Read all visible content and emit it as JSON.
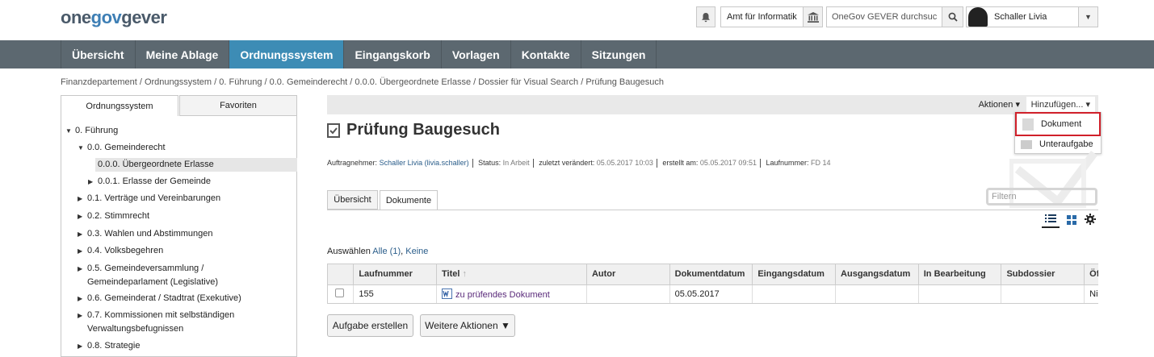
{
  "header": {
    "logo": {
      "part1": "one",
      "part2": "gov",
      "part3": "gever"
    },
    "org_label": "Amt für Informatik",
    "search_placeholder": "OneGov GEVER durchsuc",
    "user_name": "Schaller Livia"
  },
  "nav": {
    "items": [
      {
        "label": "Übersicht"
      },
      {
        "label": "Meine Ablage"
      },
      {
        "label": "Ordnungssystem",
        "active": true
      },
      {
        "label": "Eingangskorb"
      },
      {
        "label": "Vorlagen"
      },
      {
        "label": "Kontakte"
      },
      {
        "label": "Sitzungen"
      }
    ]
  },
  "breadcrumb": "Finanzdepartement / Ordnungssystem / 0. Führung / 0.0. Gemeinderecht / 0.0.0. Übergeordnete Erlasse / Dossier für Visual Search / Prüfung Baugesuch",
  "sidebar": {
    "tabs": [
      "Ordnungssystem",
      "Favoriten"
    ],
    "tree": [
      {
        "label": "0. Führung"
      },
      {
        "label": "0.0. Gemeinderecht"
      },
      {
        "label": "0.0.0. Übergeordnete Erlasse",
        "selected": true
      },
      {
        "label": "0.0.1. Erlasse der Gemeinde"
      },
      {
        "label": "0.1. Verträge und Vereinbarungen"
      },
      {
        "label": "0.2. Stimmrecht"
      },
      {
        "label": "0.3. Wahlen und Abstimmungen"
      },
      {
        "label": "0.4. Volksbegehren"
      },
      {
        "label": "0.5. Gemeindeversammlung /",
        "label2": "Gemeindeparlament (Legislative)"
      },
      {
        "label": "0.6. Gemeinderat / Stadtrat (Exekutive)"
      },
      {
        "label": "0.7. Kommissionen mit selbständigen",
        "label2": "Verwaltungsbefugnissen"
      },
      {
        "label": "0.8. Strategie"
      }
    ]
  },
  "main": {
    "actions_label": "Aktionen",
    "add_label": "Hinzufügen...",
    "add_menu": [
      "Dokument",
      "Unteraufgabe"
    ],
    "title": "Prüfung Baugesuch",
    "meta": {
      "assignee_label": "Auftragnehmer:",
      "assignee": "Schaller Livia (livia.schaller)",
      "status_label": "Status:",
      "status": "In Arbeit",
      "modified_label": "zuletzt verändert:",
      "modified": "05.05.2017 10:03",
      "created_label": "erstellt am:",
      "created": "05.05.2017 09:51",
      "seq_label": "Laufnummer:",
      "seq": "FD 14"
    },
    "tabs": [
      "Übersicht",
      "Dokumente"
    ],
    "filter_placeholder": "Filtern",
    "select": {
      "label": "Auswählen",
      "all": "Alle (1)",
      "none": "Keine"
    },
    "table": {
      "columns": [
        "Laufnummer",
        "Titel",
        "Autor",
        "Dokumentdatum",
        "Eingangsdatum",
        "Ausgangsdatum",
        "In Bearbeitung",
        "Subdossier",
        "Öffentli"
      ],
      "rows": [
        {
          "seq": "155",
          "title": "zu prüfendes Dokument",
          "author": "",
          "docdate": "05.05.2017",
          "indate": "",
          "outdate": "",
          "editing": "",
          "subdossier": "",
          "public": "Nicht ge"
        }
      ]
    },
    "buttons": {
      "create_task": "Aufgabe erstellen",
      "more_actions": "Weitere Aktionen ▼"
    }
  }
}
